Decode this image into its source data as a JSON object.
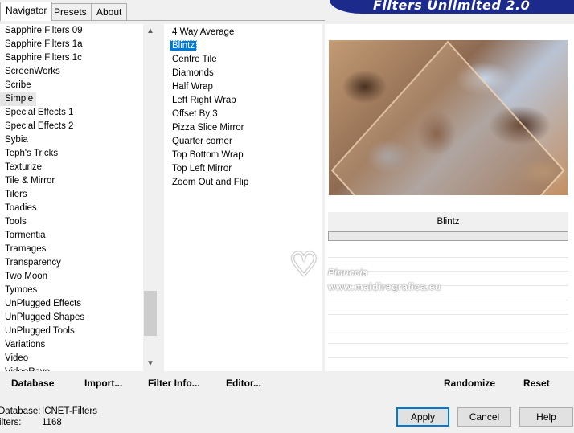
{
  "tabs": [
    "Navigator",
    "Presets",
    "About"
  ],
  "banner_title": "Filters Unlimited 2.0",
  "categories": [
    "Sapphire Filters 09",
    "Sapphire Filters 1a",
    "Sapphire Filters 1c",
    "ScreenWorks",
    "Scribe",
    "Simple",
    "Special Effects 1",
    "Special Effects 2",
    "Sybia",
    "Teph's Tricks",
    "Texturize",
    "Tile & Mirror",
    "Tilers",
    "Toadies",
    "Tools",
    "Tormentia",
    "Tramages",
    "Transparency",
    "Two Moon",
    "Tymoes",
    "UnPlugged Effects",
    "UnPlugged Shapes",
    "UnPlugged Tools",
    "Variations",
    "Video",
    "VideoRave"
  ],
  "selected_category": "Simple",
  "filters": [
    "4 Way Average",
    "Blintz",
    "Centre Tile",
    "Diamonds",
    "Half Wrap",
    "Left Right Wrap",
    "Offset By 3",
    "Pizza Slice Mirror",
    "Quarter corner",
    "Top Bottom Wrap",
    "Top Left Mirror",
    "Zoom Out and Flip"
  ],
  "selected_filter": "Blintz",
  "preview_filter_name": "Blintz",
  "watermark": {
    "name": "Pinuccia",
    "url": "www.maidiregrafica.eu"
  },
  "left_buttons": {
    "database": "Database",
    "import": "Import...",
    "filter_info": "Filter Info...",
    "editor": "Editor..."
  },
  "right_buttons": {
    "randomize": "Randomize",
    "reset": "Reset"
  },
  "info": {
    "database_label": "Database:",
    "database_value": "ICNET-Filters",
    "filters_label": "Filters:",
    "filters_value": "1168"
  },
  "dialog_buttons": {
    "apply": "Apply",
    "cancel": "Cancel",
    "help": "Help"
  },
  "colors": {
    "selection": "#0078d7",
    "banner": "#1c2a8c"
  },
  "icons": {
    "scroll_up": "chevron-up-icon",
    "scroll_down": "chevron-down-icon"
  }
}
